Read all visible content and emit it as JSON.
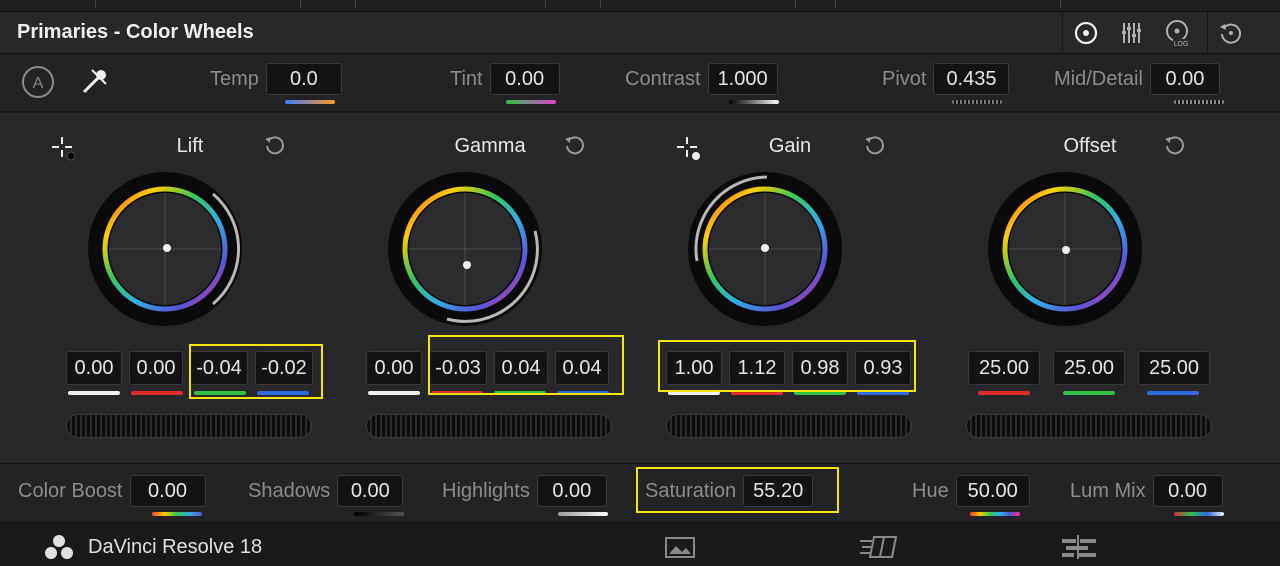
{
  "panel_title": "Primaries - Color Wheels",
  "adjust": {
    "temp_label": "Temp",
    "temp_value": "0.0",
    "tint_label": "Tint",
    "tint_value": "0.00",
    "contrast_label": "Contrast",
    "contrast_value": "1.000",
    "pivot_label": "Pivot",
    "pivot_value": "0.435",
    "middetail_label": "Mid/Detail",
    "middetail_value": "0.00"
  },
  "wheels": [
    {
      "label": "Lift",
      "values": [
        "0.00",
        "0.00",
        "-0.04",
        "-0.02"
      ]
    },
    {
      "label": "Gamma",
      "values": [
        "0.00",
        "-0.03",
        "0.04",
        "0.04"
      ]
    },
    {
      "label": "Gain",
      "values": [
        "1.00",
        "1.12",
        "0.98",
        "0.93"
      ]
    },
    {
      "label": "Offset",
      "values": [
        "25.00",
        "25.00",
        "25.00"
      ]
    }
  ],
  "bottom": {
    "color_boost_label": "Color Boost",
    "color_boost_value": "0.00",
    "shadows_label": "Shadows",
    "shadows_value": "0.00",
    "highlights_label": "Highlights",
    "highlights_value": "0.00",
    "saturation_label": "Saturation",
    "saturation_value": "55.20",
    "hue_label": "Hue",
    "hue_value": "50.00",
    "lummix_label": "Lum Mix",
    "lummix_value": "0.00"
  },
  "status": {
    "app_name": "DaVinci Resolve 18"
  },
  "colors": {
    "highlight": "#f5e610",
    "red": "#e02a2a",
    "green": "#2fc246",
    "blue": "#2f6be0",
    "white": "#f0f0f0"
  },
  "icons": [
    "auto-balance-icon",
    "eyedropper-icon",
    "color-wheels-mode-icon",
    "bars-mode-icon",
    "log-mode-icon",
    "reset-all-icon",
    "picker-icon",
    "reset-icon",
    "resolve-logo-icon",
    "media-page-icon",
    "cut-page-icon",
    "edit-page-icon"
  ]
}
